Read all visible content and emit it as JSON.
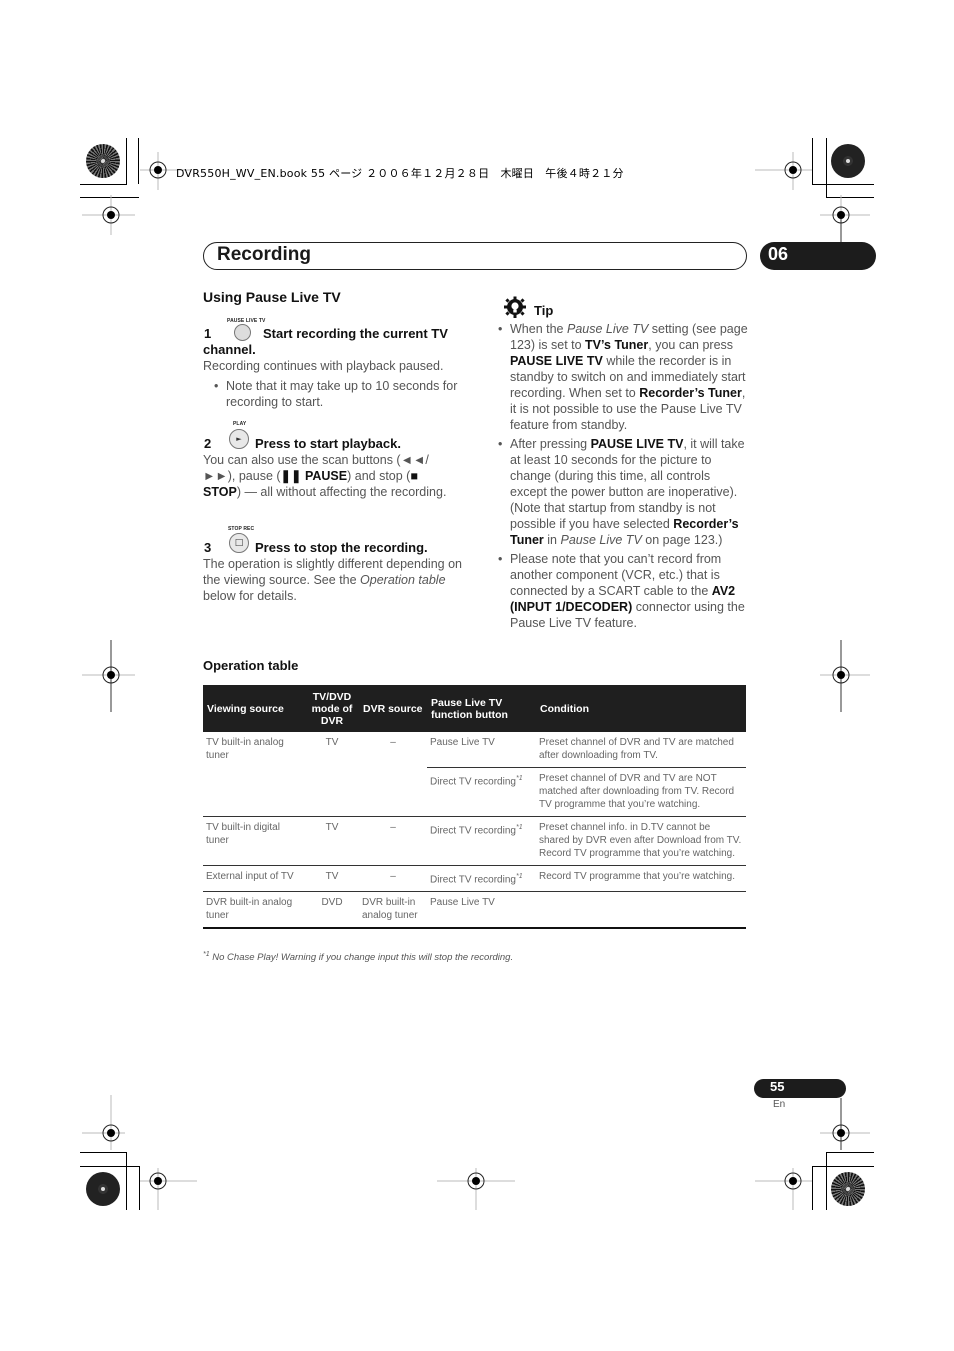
{
  "print_header": "DVR550H_WV_EN.book  55 ページ  ２００６年１２月２８日　木曜日　午後４時２１分",
  "chapter": {
    "title": "Recording",
    "number": "06"
  },
  "left_column": {
    "section_title": "Using Pause Live TV",
    "steps": [
      {
        "num": "1",
        "button_label": "PAUSE LIVE TV",
        "button_icon": "pause-live-tv-button-icon",
        "title_line1": "Start recording the current TV",
        "title_line2": "channel.",
        "body": "Recording continues with playback paused.",
        "bullet": "Note that it may take up to 10 seconds for recording to start."
      },
      {
        "num": "2",
        "button_label": "PLAY",
        "button_icon": "play-button-icon",
        "button_glyph": "►",
        "title": "Press to start playback.",
        "body_parts": {
          "a": "You can also use the scan buttons (◄◄/ ►►), pause (",
          "pause_label": "❚❚ PAUSE",
          "b": ") and stop (",
          "stop_label": "■ STOP",
          "c": ") — all without affecting the recording."
        }
      },
      {
        "num": "3",
        "button_label": "STOP REC",
        "button_icon": "stop-rec-button-icon",
        "button_glyph": "□",
        "title": "Press to stop the recording.",
        "body_parts": {
          "a": "The operation is slightly different depending on the viewing source. See the ",
          "italic": "Operation table",
          "b": " below for details."
        }
      }
    ]
  },
  "tip": {
    "icon": "lightbulb-gear-icon",
    "title": "Tip",
    "bullets": [
      {
        "p1": "When the ",
        "i1": "Pause Live TV",
        "p2": " setting (see page 123) is set to ",
        "b1": "TV’s Tuner",
        "p3": ", you can press ",
        "b2": "PAUSE LIVE TV",
        "p4": " while the recorder is in standby to switch on and immediately start recording. When set to ",
        "b3": "Recorder’s Tuner",
        "p5": ", it is not possible to use the Pause Live TV feature from standby."
      },
      {
        "p1": "After pressing ",
        "b1": "PAUSE LIVE TV",
        "p2": ", it will take at least 10 seconds for the picture to change (during this time, all controls except the power button are inoperative). (Note that startup from standby is not possible if you have selected ",
        "b2": "Recorder’s Tuner",
        "p3": " in ",
        "i1": "Pause Live TV",
        "p4": " on page 123.)"
      },
      {
        "p1": "Please note that you can’t record from another component (VCR, etc.) that is connected by a SCART cable to the ",
        "b1": "AV2 (INPUT 1/DECODER)",
        "p2": " connector using the Pause Live TV feature."
      }
    ]
  },
  "operation_table": {
    "title": "Operation table",
    "headers": [
      "Viewing source",
      "TV/DVD mode of DVR",
      "DVR source",
      "Pause Live TV function button",
      "Condition"
    ],
    "footnote_marker": "*1",
    "rows": [
      {
        "viewing_source": "TV built-in analog tuner",
        "mode": "TV",
        "dvr_source": "–",
        "sub": [
          {
            "button": "Pause Live TV",
            "fn": "",
            "condition": "Preset channel of DVR and TV are matched after downloading from TV."
          },
          {
            "button": "Direct TV recording",
            "fn": "*1",
            "condition": "Preset channel of DVR and TV are NOT matched after downloading from TV. Record TV programme that you’re watching."
          }
        ]
      },
      {
        "viewing_source": "TV built-in digital tuner",
        "mode": "TV",
        "dvr_source": "–",
        "button": "Direct TV recording",
        "fn": "*1",
        "condition": "Preset channel info. in D.TV cannot be shared by DVR even after Download from TV. Record TV programme that you’re watching."
      },
      {
        "viewing_source": "External input of TV",
        "mode": "TV",
        "dvr_source": "–",
        "button": "Direct TV recording",
        "fn": "*1",
        "condition": "Record TV programme that you’re watching."
      },
      {
        "viewing_source": "DVR built-in analog tuner",
        "mode": "DVD",
        "dvr_source": "DVR built-in analog tuner",
        "button": "Pause Live TV",
        "fn": "",
        "condition": ""
      }
    ],
    "footnote": {
      "marker": "*1",
      "text": " No Chase Play! Warning if you change input this will stop the recording."
    }
  },
  "page": {
    "number": "55",
    "lang": "En"
  }
}
